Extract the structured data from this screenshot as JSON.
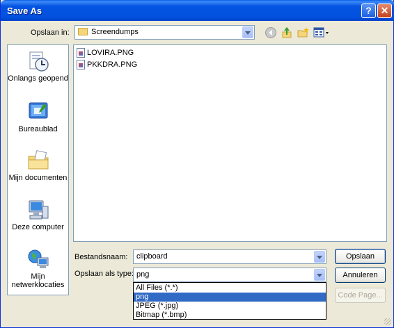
{
  "window": {
    "title": "Save As"
  },
  "toolbar": {
    "look_in_label": "Opslaan in:",
    "look_in_value": "Screendumps"
  },
  "places": [
    {
      "label": "Onlangs geopend",
      "icon": "recent-documents-icon"
    },
    {
      "label": "Bureaublad",
      "icon": "desktop-icon"
    },
    {
      "label": "Mijn documenten",
      "icon": "my-documents-icon"
    },
    {
      "label": "Deze computer",
      "icon": "my-computer-icon"
    },
    {
      "label": "Mijn netwerklocaties",
      "icon": "network-places-icon"
    }
  ],
  "files": [
    {
      "name": "LOVIRA.PNG"
    },
    {
      "name": "PKKDRA.PNG"
    }
  ],
  "filename": {
    "label": "Bestandsnaam:",
    "value": "clipboard"
  },
  "filetype": {
    "label": "Opslaan als type:",
    "value": "png",
    "options": [
      "All Files (*.*)",
      "png",
      "JPEG (*.jpg)",
      "Bitmap (*.bmp)"
    ],
    "selected_index": 1
  },
  "buttons": {
    "save": "Opslaan",
    "cancel": "Annuleren",
    "code_page": "Code Page..."
  }
}
